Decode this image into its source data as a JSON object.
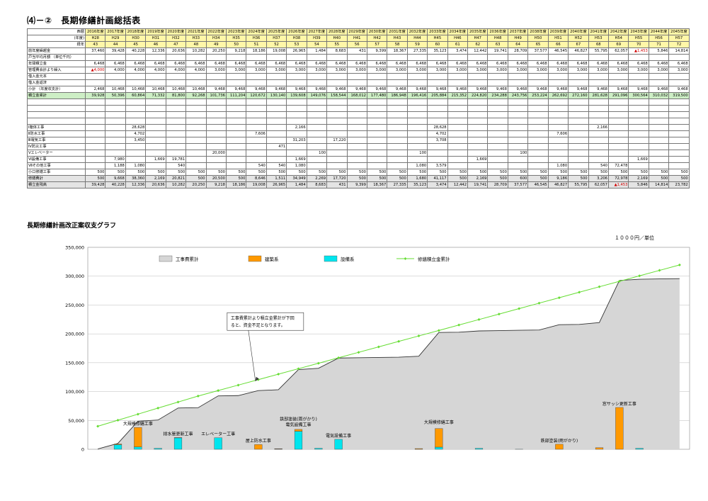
{
  "title": "⑷－②　長期修繕計画総括表",
  "table": {
    "row_labels": {
      "western": "西暦",
      "nendo": "(年度)",
      "elapsed": "経年",
      "prev_balance": "前年度繰越金",
      "avg_monthly": "戸当平均月額 （単位千円）",
      "annual_reserve": "年間積立金",
      "mgmt_transfer": "管理費会計より繰入",
      "borrow_principal": "借入金元本",
      "borrow_repay": "借入金返済",
      "subtotal": "小計 （年度収支計）",
      "cumulative": "積立金累計",
      "cat1": "Ⅰ躯体工事",
      "cat2": "Ⅱ防水工事",
      "cat3": "Ⅲ電気工事",
      "cat4": "Ⅳ防災工事",
      "cat5": "Ⅴエレベーター",
      "cat6": "Ⅵ設備工事",
      "cat7": "Ⅶその他工事",
      "small_repair": "小口修繕工事",
      "repair_total": "修繕費計",
      "balance": "積立金残高"
    },
    "years": [
      "2016年度",
      "2017年度",
      "2018年度",
      "2019年度",
      "2020年度",
      "2021年度",
      "2022年度",
      "2023年度",
      "2024年度",
      "2025年度",
      "2026年度",
      "2027年度",
      "2028年度",
      "2029年度",
      "2030年度",
      "2031年度",
      "2032年度",
      "2033年度",
      "2034年度",
      "2035年度",
      "2036年度",
      "2037年度",
      "2038年度",
      "2039年度",
      "2040年度",
      "2041年度",
      "2042年度",
      "2043年度",
      "2044年度",
      "2045年度"
    ],
    "eras": [
      "H28",
      "H29",
      "H30",
      "H31",
      "H32",
      "H33",
      "H34",
      "H35",
      "H36",
      "H37",
      "H38",
      "H39",
      "H40",
      "H41",
      "H42",
      "H43",
      "H44",
      "H45",
      "H46",
      "H47",
      "H48",
      "H49",
      "H50",
      "H51",
      "H52",
      "H53",
      "H54",
      "H55",
      "H56",
      "H57"
    ],
    "ages": [
      "43",
      "44",
      "45",
      "46",
      "47",
      "48",
      "49",
      "50",
      "51",
      "52",
      "53",
      "54",
      "55",
      "56",
      "57",
      "58",
      "59",
      "60",
      "61",
      "62",
      "63",
      "64",
      "65",
      "66",
      "67",
      "68",
      "69",
      "70",
      "71",
      "72"
    ],
    "prev_balance": [
      "37,460",
      "39,428",
      "40,228",
      "12,336",
      "20,636",
      "10,282",
      "20,250",
      "9,218",
      "18,186",
      "19,008",
      "26,965",
      "1,484",
      "8,683",
      "431",
      "9,399",
      "18,367",
      "27,335",
      "35,123",
      "3,474",
      "12,442",
      "19,741",
      "28,709",
      "37,577",
      "46,545",
      "46,827",
      "55,795",
      "62,057",
      "▲1,453",
      "5,846",
      "14,814"
    ],
    "prev_balance_neg": [
      27
    ],
    "annual_reserve": [
      "6,468",
      "6,468",
      "6,468",
      "6,468",
      "6,468",
      "6,468",
      "6,468",
      "6,468",
      "6,468",
      "6,468",
      "6,468",
      "6,468",
      "6,468",
      "6,468",
      "6,468",
      "6,468",
      "6,468",
      "6,468",
      "6,468",
      "6,468",
      "6,468",
      "6,468",
      "6,468",
      "6,468",
      "6,468",
      "6,468",
      "6,468",
      "6,468",
      "6,468",
      "6,468"
    ],
    "mgmt_transfer": [
      "▲4,000",
      "4,000",
      "4,000",
      "4,000",
      "4,000",
      "4,000",
      "3,000",
      "3,000",
      "3,000",
      "3,000",
      "3,000",
      "3,000",
      "3,000",
      "3,000",
      "3,000",
      "3,000",
      "3,000",
      "3,000",
      "3,000",
      "3,000",
      "3,000",
      "3,000",
      "3,000",
      "3,000",
      "3,000",
      "3,000",
      "3,000",
      "3,000",
      "3,000",
      "3,000"
    ],
    "mgmt_transfer_neg": [
      0
    ],
    "subtotal": [
      "2,468",
      "10,468",
      "10,468",
      "10,468",
      "10,468",
      "10,468",
      "9,468",
      "9,468",
      "9,468",
      "9,468",
      "9,468",
      "9,468",
      "9,468",
      "9,468",
      "9,468",
      "9,468",
      "9,468",
      "9,468",
      "9,468",
      "9,468",
      "9,468",
      "9,468",
      "9,468",
      "9,468",
      "9,468",
      "9,468",
      "9,468",
      "9,468",
      "9,468",
      "9,468"
    ],
    "cumulative": [
      "39,928",
      "50,396",
      "60,864",
      "71,332",
      "81,800",
      "92,268",
      "101,736",
      "111,204",
      "120,672",
      "130,140",
      "139,608",
      "149,076",
      "158,544",
      "168,012",
      "177,480",
      "186,948",
      "196,416",
      "205,884",
      "215,352",
      "224,820",
      "234,288",
      "243,756",
      "253,224",
      "262,692",
      "272,160",
      "281,628",
      "291,096",
      "300,564",
      "310,032",
      "319,500"
    ],
    "cat1": [
      "",
      "",
      "28,628",
      "",
      "",
      "",
      "",
      "",
      "",
      "",
      "2,166",
      "",
      "",
      "",
      "",
      "",
      "",
      "28,628",
      "",
      "",
      "",
      "",
      "",
      "",
      "",
      "2,166",
      "",
      "",
      "",
      ""
    ],
    "cat2": [
      "",
      "",
      "4,702",
      "",
      "",
      "",
      "",
      "",
      "7,606",
      "",
      "",
      "",
      "",
      "",
      "",
      "",
      "",
      "4,702",
      "",
      "",
      "",
      "",
      "",
      "7,606",
      "",
      "",
      "",
      "",
      "",
      ""
    ],
    "cat3": [
      "",
      "",
      "3,450",
      "",
      "",
      "",
      "",
      "",
      "",
      "",
      "31,203",
      "",
      "17,220",
      "",
      "",
      "",
      "",
      "3,708",
      "",
      "",
      "",
      "",
      "",
      "",
      "",
      "",
      "",
      "",
      "",
      ""
    ],
    "cat4": [
      "",
      "",
      "",
      "",
      "",
      "",
      "",
      "",
      "",
      "471",
      "",
      "",
      "",
      "",
      "",
      "",
      "",
      "",
      "",
      "",
      "",
      "",
      "",
      "",
      "",
      "",
      "",
      "",
      "",
      ""
    ],
    "cat5": [
      "",
      "",
      "",
      "",
      "",
      "",
      "20,000",
      "",
      "",
      "",
      "",
      "100",
      "",
      "",
      "",
      "",
      "100",
      "",
      "",
      "",
      "",
      "100",
      "",
      "",
      "",
      "",
      "",
      "",
      "",
      ""
    ],
    "cat6": [
      "",
      "7,980",
      "",
      "1,669",
      "19,781",
      "",
      "",
      "",
      "",
      "",
      "1,669",
      "",
      "",
      "",
      "",
      "",
      "",
      "",
      "",
      "1,669",
      "",
      "",
      "",
      "",
      "",
      "",
      "",
      "1,669",
      "",
      ""
    ],
    "cat7": [
      "",
      "1,188",
      "1,080",
      "",
      "540",
      "",
      "",
      "",
      "540",
      "540",
      "1,080",
      "",
      "",
      "",
      "",
      "",
      "1,080",
      "3,579",
      "",
      "",
      "",
      "",
      "",
      "1,080",
      "",
      "540",
      "72,478",
      "",
      "",
      ""
    ],
    "small_repair": [
      "500",
      "500",
      "500",
      "500",
      "500",
      "500",
      "500",
      "500",
      "500",
      "500",
      "500",
      "500",
      "500",
      "500",
      "500",
      "500",
      "500",
      "500",
      "500",
      "500",
      "500",
      "500",
      "500",
      "500",
      "500",
      "500",
      "500",
      "500",
      "500",
      "500"
    ],
    "repair_total": [
      "500",
      "9,668",
      "38,360",
      "2,169",
      "20,821",
      "500",
      "20,500",
      "500",
      "8,646",
      "1,511",
      "34,949",
      "2,269",
      "17,720",
      "500",
      "500",
      "500",
      "1,680",
      "41,117",
      "500",
      "2,169",
      "500",
      "600",
      "500",
      "9,186",
      "500",
      "3,206",
      "72,978",
      "2,169",
      "500",
      "500"
    ],
    "balance": [
      "39,428",
      "40,228",
      "12,336",
      "20,636",
      "10,282",
      "20,250",
      "9,218",
      "18,186",
      "19,008",
      "26,965",
      "1,484",
      "8,683",
      "431",
      "9,399",
      "18,367",
      "27,335",
      "35,123",
      "3,474",
      "12,442",
      "19,741",
      "28,709",
      "37,577",
      "46,545",
      "46,827",
      "55,795",
      "62,057",
      "▲1,453",
      "5,846",
      "14,814",
      "23,782"
    ],
    "balance_neg": [
      26
    ]
  },
  "chart_title": "長期修繕計画改正案収支グラフ",
  "chart_unit": "１０００円／単位",
  "chart_data": {
    "type": "area",
    "title": "長期修繕計画改正案収支グラフ",
    "unit": "１０００円／単位",
    "categories": [
      "2016年度",
      "2017年度",
      "2018年度",
      "2019年度",
      "2020年度",
      "2021年度",
      "2022年度",
      "2023年度",
      "2024年度",
      "2025年度",
      "2026年度",
      "2027年度",
      "2028年度",
      "2029年度",
      "2030年度",
      "2031年度",
      "2032年度",
      "2033年度",
      "2034年度",
      "2035年度",
      "2036年度",
      "2037年度",
      "2038年度",
      "2039年度",
      "2040年度",
      "2041年度",
      "2042年度",
      "2043年度",
      "2044年度",
      "2045年度"
    ],
    "ylim": [
      0,
      350000
    ],
    "yticks": [
      "0",
      "50,000",
      "100,000",
      "150,000",
      "200,000",
      "250,000",
      "300,000",
      "350,000"
    ],
    "yticks_values": [
      0,
      50000,
      100000,
      150000,
      200000,
      250000,
      300000,
      350000
    ],
    "legend_placement": "top",
    "series": [
      {
        "name": "工事費累計",
        "kind": "area",
        "color": "#d6d6d6",
        "values": [
          500,
          10168,
          48528,
          50697,
          71518,
          72018,
          92518,
          93018,
          101664,
          103175,
          138124,
          140393,
          158113,
          158613,
          159113,
          159613,
          161293,
          202410,
          202910,
          205079,
          205579,
          206179,
          206679,
          215865,
          216365,
          219571,
          292549,
          294718,
          295218,
          295718
        ]
      },
      {
        "name": "建築系",
        "kind": "bar",
        "color": "#ff9900",
        "values": [
          0,
          1188,
          33708,
          0,
          540,
          0,
          0,
          0,
          8146,
          540,
          3246,
          0,
          0,
          0,
          0,
          0,
          1080,
          32207,
          0,
          0,
          0,
          0,
          0,
          8686,
          0,
          2706,
          72478,
          0,
          0,
          0
        ]
      },
      {
        "name": "設備系",
        "kind": "bar",
        "color": "#00e5ee",
        "values": [
          0,
          7980,
          4152,
          1669,
          19781,
          0,
          20000,
          0,
          0,
          471,
          31203,
          1769,
          17220,
          0,
          0,
          0,
          100,
          3708,
          0,
          1669,
          0,
          100,
          0,
          0,
          0,
          0,
          0,
          1669,
          0,
          0
        ]
      },
      {
        "name": "修繕積立金累計",
        "kind": "line",
        "color": "#66dd33",
        "values": [
          39928,
          50396,
          60864,
          71332,
          81800,
          92268,
          101736,
          111204,
          120672,
          130140,
          139608,
          149076,
          158544,
          168012,
          177480,
          186948,
          196416,
          205884,
          215352,
          224820,
          234288,
          243756,
          253224,
          262692,
          272160,
          281628,
          291096,
          300564,
          310032,
          319500
        ]
      }
    ],
    "annotations": [
      {
        "text": "大規模修繕工事",
        "index": 2,
        "y": 42000
      },
      {
        "text": "排水管更新工事",
        "index": 4,
        "y": 24000
      },
      {
        "text": "エレベーター工事",
        "index": 6,
        "y": 24000
      },
      {
        "text": "屋上防水工事",
        "index": 8,
        "y": 12000
      },
      {
        "text": "鉄部塗装(雨がかり)",
        "index": 10,
        "y": 50000
      },
      {
        "text": "電気設備工事",
        "index": 10,
        "y": 40000
      },
      {
        "text": "電気設備工事",
        "index": 12,
        "y": 21000
      },
      {
        "text": "大規模修繕工事",
        "index": 17,
        "y": 44000
      },
      {
        "text": "鉄部塗装(雨がかり)",
        "index": 23,
        "y": 12000
      },
      {
        "text": "窓サッシ更新工事",
        "index": 26,
        "y": 76000
      }
    ],
    "callout": {
      "text": "工事費累計より積立金累計が下回ると、資金不足となります。",
      "line1": "工事費累計より積立金累計が下回",
      "line2": "ると、資金不足となります。",
      "index": 6.8,
      "y": 222000,
      "point_index": 6.8,
      "point_y": 112000
    }
  }
}
